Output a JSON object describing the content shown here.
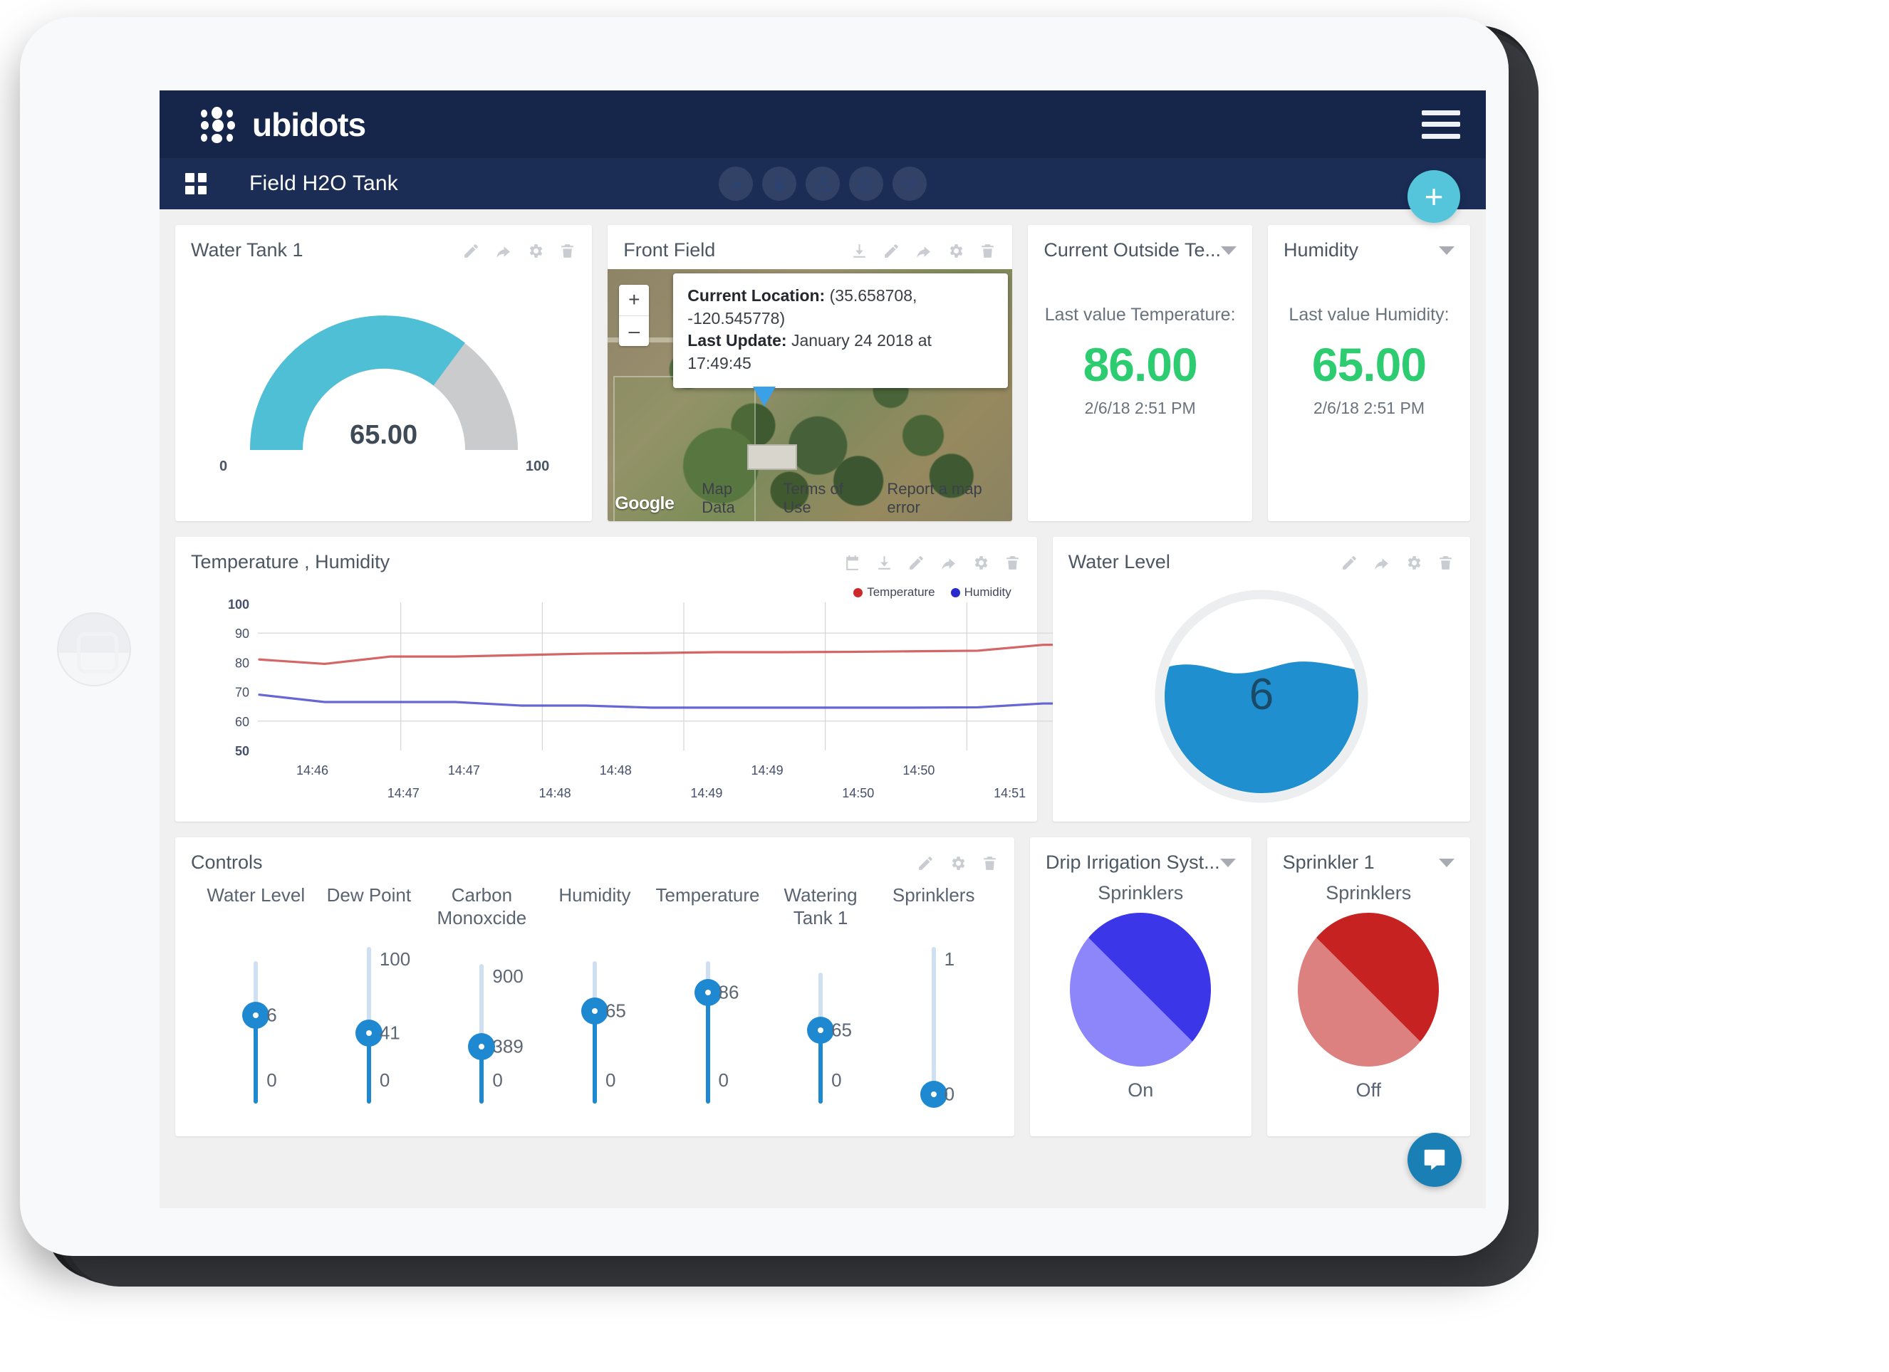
{
  "app": {
    "brand": "ubidots",
    "dashboard_title": "Field H2O Tank",
    "hamburger_icon": "hamburger-menu-icon",
    "grid_icon": "grid-icon",
    "add_widget_label": "+",
    "toolbar_icons": [
      "share-icon",
      "lock-icon",
      "hierarchy-icon",
      "duplicate-icon",
      "screen-icon"
    ],
    "intercom_icon": "chat-bubble-icon"
  },
  "widgets": {
    "water_tank": {
      "title": "Water Tank 1",
      "value": "65.00",
      "min": "0",
      "max": "100",
      "percent": 65,
      "fill_color": "#4fbfd6",
      "track_color": "#c9cbcd",
      "tools": [
        "pencil-icon",
        "share-icon",
        "gear-icon",
        "trash-icon"
      ]
    },
    "front_field": {
      "title": "Front Field",
      "zoom_in": "+",
      "zoom_out": "–",
      "location_label": "Current Location:",
      "location_value": "(35.658708, -120.545778)",
      "last_update_label": "Last Update:",
      "last_update_value": "January 24 2018 at 17:49:45",
      "attribution": "Google",
      "footer_links": [
        "Map Data",
        "Terms of Use",
        "Report a map error"
      ],
      "tools": [
        "download-icon",
        "pencil-icon",
        "share-icon",
        "gear-icon",
        "trash-icon"
      ]
    },
    "outside_temperature": {
      "title": "Current Outside Te...",
      "label": "Last value Temperature:",
      "value": "86.00",
      "timestamp": "2/6/18 2:51 PM",
      "value_color": "#2ecc71",
      "tools": [
        "chevron-down-icon"
      ]
    },
    "humidity": {
      "title": "Humidity",
      "label": "Last value Humidity:",
      "value": "65.00",
      "timestamp": "2/6/18 2:51 PM",
      "value_color": "#2ecc71",
      "tools": [
        "chevron-down-icon"
      ]
    },
    "chart": {
      "title": "Temperature , Humidity",
      "tools": [
        "calendar-icon",
        "download-icon",
        "pencil-icon",
        "share-icon",
        "gear-icon",
        "trash-icon"
      ]
    },
    "water_level": {
      "title": "Water Level",
      "value": "6",
      "fill_color": "#1f8fd0",
      "tools": [
        "pencil-icon",
        "share-icon",
        "gear-icon",
        "trash-icon"
      ]
    },
    "controls": {
      "title": "Controls",
      "tools": [
        "pencil-icon",
        "gear-icon",
        "trash-icon"
      ],
      "sliders": [
        {
          "name": "Water Level",
          "value": "6",
          "min": "0",
          "max": "",
          "pos": 62
        },
        {
          "name": "Dew Point",
          "value": "41",
          "min": "0",
          "max": "100",
          "pos": 45
        },
        {
          "name": "Carbon Monoxcide",
          "value": "389",
          "min": "0",
          "max": "900",
          "pos": 41
        },
        {
          "name": "Humidity",
          "value": "65",
          "min": "0",
          "max": "",
          "pos": 65
        },
        {
          "name": "Temperature",
          "value": "86",
          "min": "0",
          "max": "",
          "pos": 78
        },
        {
          "name": "Watering Tank 1",
          "value": "65",
          "min": "0",
          "max": "",
          "pos": 56
        },
        {
          "name": "Sprinklers",
          "value": "0",
          "min": "",
          "max": "1",
          "pos": 6
        }
      ]
    },
    "drip_irrigation": {
      "title": "Drip Irrigation Syst...",
      "subtitle": "Sprinklers",
      "state": "On",
      "color_dark": "#3b36e8",
      "color_light": "#8d86fa",
      "tools": [
        "chevron-down-icon"
      ]
    },
    "sprinkler_1": {
      "title": "Sprinkler 1",
      "subtitle": "Sprinklers",
      "state": "Off",
      "color_dark": "#c62222",
      "color_light": "#dd8080",
      "tools": [
        "chevron-down-icon"
      ]
    }
  },
  "chart_data": {
    "type": "line",
    "title": "Temperature , Humidity",
    "xlabel": "",
    "ylabel": "",
    "ylim": [
      50,
      100
    ],
    "yticks": [
      100,
      90,
      80,
      70,
      60,
      50
    ],
    "xticks_top": [
      "14:46",
      "14:47",
      "14:48",
      "14:49",
      "14:50"
    ],
    "xticks_bottom": [
      "14:47",
      "14:48",
      "14:49",
      "14:50",
      "14:51"
    ],
    "grid": true,
    "legend_position": "top-right",
    "series": [
      {
        "name": "Temperature",
        "color": "#cc4b4b",
        "x": [
          "14:45.8",
          "14:46.0",
          "14:46.2",
          "14:47.0",
          "14:47.3",
          "14:47.5",
          "14:48.0",
          "14:48.5",
          "14:49.0",
          "14:49.5",
          "14:50.0",
          "14:50.4",
          "14:50.7",
          "14:51.0"
        ],
        "values": [
          81,
          79.5,
          82,
          82,
          82.5,
          83,
          83.2,
          83.5,
          83.5,
          83.6,
          83.8,
          84,
          86,
          86.2
        ]
      },
      {
        "name": "Humidity",
        "color": "#4b4bcc",
        "x": [
          "14:45.8",
          "14:46.0",
          "14:46.2",
          "14:47.0",
          "14:47.3",
          "14:47.5",
          "14:48.0",
          "14:48.5",
          "14:49.0",
          "14:49.5",
          "14:50.0",
          "14:50.4",
          "14:50.7",
          "14:51.0"
        ],
        "values": [
          69,
          66.5,
          66.5,
          66.5,
          65.3,
          65.3,
          64.6,
          64.6,
          64.6,
          64.6,
          64.6,
          64.7,
          66,
          66
        ]
      }
    ]
  }
}
